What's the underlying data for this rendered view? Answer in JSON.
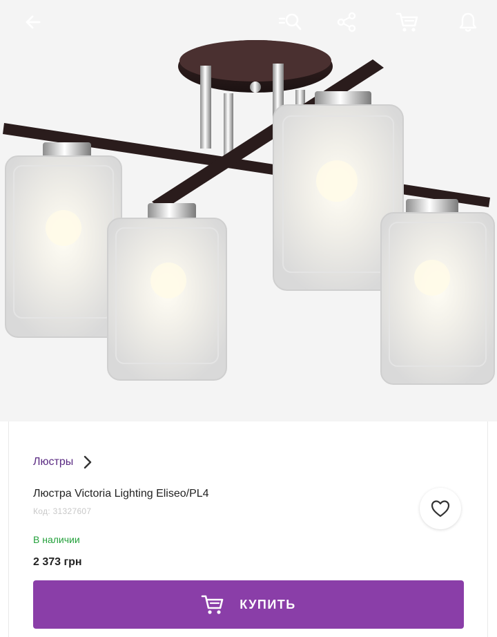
{
  "topbar": {
    "back_icon": "arrow-left-icon",
    "search_icon": "search-list-icon",
    "share_icon": "share-icon",
    "cart_icon": "cart-icon",
    "notifications_icon": "bell-icon"
  },
  "product_image": {
    "icon": "chandelier-photo"
  },
  "breadcrumb": {
    "label": "Люстры",
    "icon": "chevron-right-icon"
  },
  "product": {
    "title": "Люстра Victoria Lighting Eliseo/PL4",
    "sku": "Код: 31327607",
    "availability": "В наличии",
    "price": "2 373 грн",
    "favorite_icon": "heart-outline-icon"
  },
  "buy_button": {
    "label": "КУПИТЬ",
    "icon": "cart-icon"
  },
  "colors": {
    "accent": "#8a3ea8",
    "breadcrumb": "#5a2a82",
    "in_stock": "#22a03a",
    "text": "#222222",
    "muted": "#c8c8c8"
  }
}
